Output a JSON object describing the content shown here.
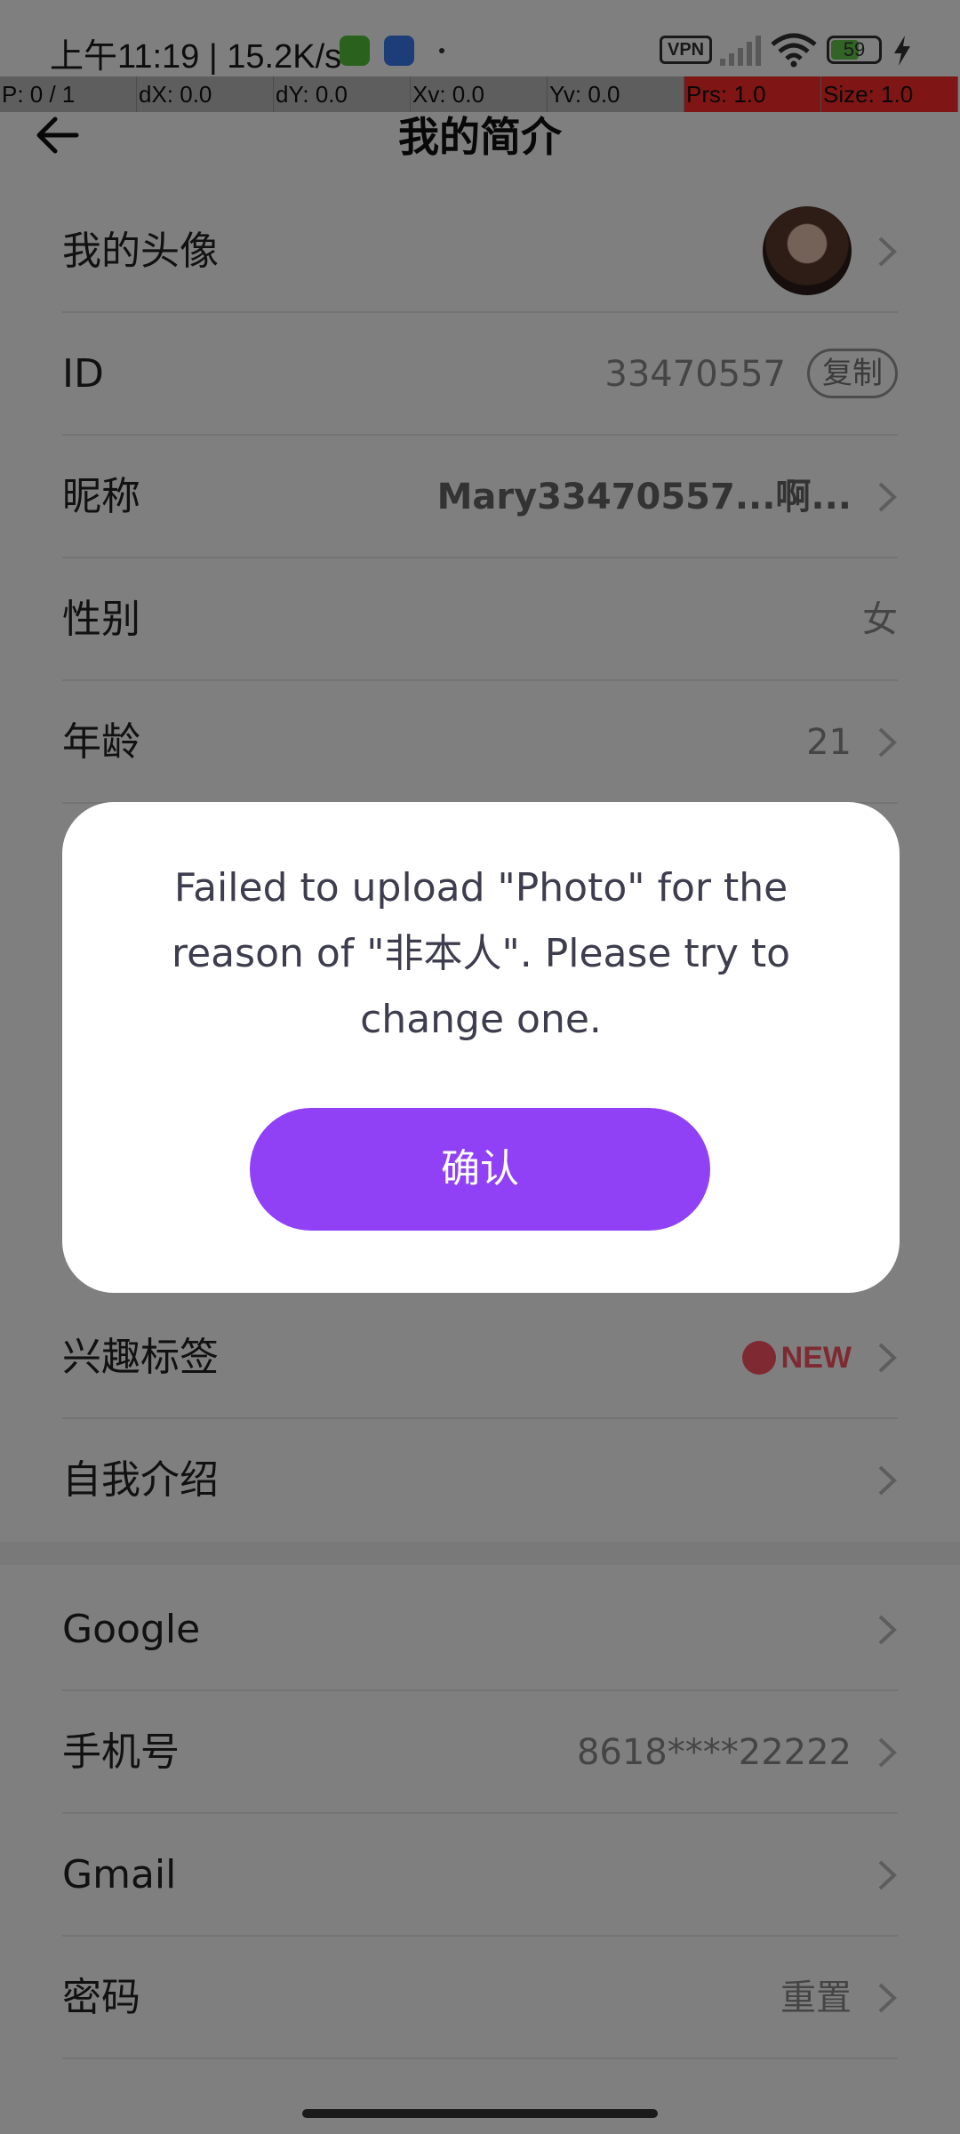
{
  "status_bar": {
    "time_speed": "上午11:19 | 15.2K/s",
    "vpn": "VPN",
    "battery": "59"
  },
  "debug_bar": {
    "p": "P: 0 / 1",
    "dx": "dX: 0.0",
    "dy": "dY: 0.0",
    "xv": "Xv: 0.0",
    "yv": "Yv: 0.0",
    "prs": "Prs: 1.0",
    "size": "Size: 1.0"
  },
  "header": {
    "title": "我的简介"
  },
  "profile": {
    "avatar_label": "我的头像",
    "id_label": "ID",
    "id_value": "33470557",
    "copy_label": "复制",
    "nickname_label": "昵称",
    "nickname_value": "Mary33470557...啊...",
    "gender_label": "性别",
    "gender_value": "女",
    "age_label": "年龄",
    "age_value": "21",
    "interests_label": "兴趣标签",
    "new_badge": "NEW",
    "intro_label": "自我介绍"
  },
  "account": {
    "google_label": "Google",
    "phone_label": "手机号",
    "phone_value": "8618****22222",
    "gmail_label": "Gmail",
    "password_label": "密码",
    "password_value": "重置"
  },
  "dialog": {
    "message": "Failed to upload \"Photo\" for the reason of \"非本人\". Please try to change one.",
    "confirm_label": "确认"
  },
  "colors": {
    "accent": "#9040f5",
    "badge": "#ff5467"
  }
}
